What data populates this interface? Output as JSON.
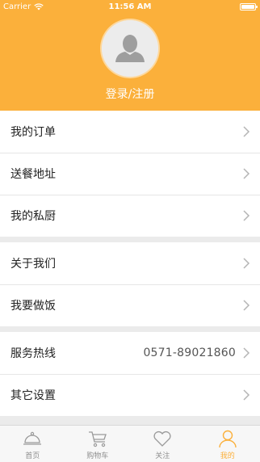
{
  "status_bar": {
    "carrier": "Carrier",
    "time": "11:56 AM"
  },
  "profile": {
    "login_label": "登录/注册"
  },
  "menu_groups": [
    {
      "items": [
        {
          "label": "我的订单"
        },
        {
          "label": "送餐地址"
        },
        {
          "label": "我的私厨"
        }
      ]
    },
    {
      "items": [
        {
          "label": "关于我们"
        },
        {
          "label": "我要做饭"
        }
      ]
    },
    {
      "items": [
        {
          "label": "服务热线",
          "value": "0571-89021860"
        },
        {
          "label": "其它设置"
        }
      ]
    }
  ],
  "tabbar": {
    "tabs": [
      {
        "label": "首页",
        "icon": "cloche-icon"
      },
      {
        "label": "购物车",
        "icon": "cart-icon"
      },
      {
        "label": "关注",
        "icon": "heart-icon"
      },
      {
        "label": "我的",
        "icon": "person-icon",
        "active": true
      }
    ]
  },
  "colors": {
    "accent": "#fbb03b",
    "background": "#ebebeb"
  }
}
